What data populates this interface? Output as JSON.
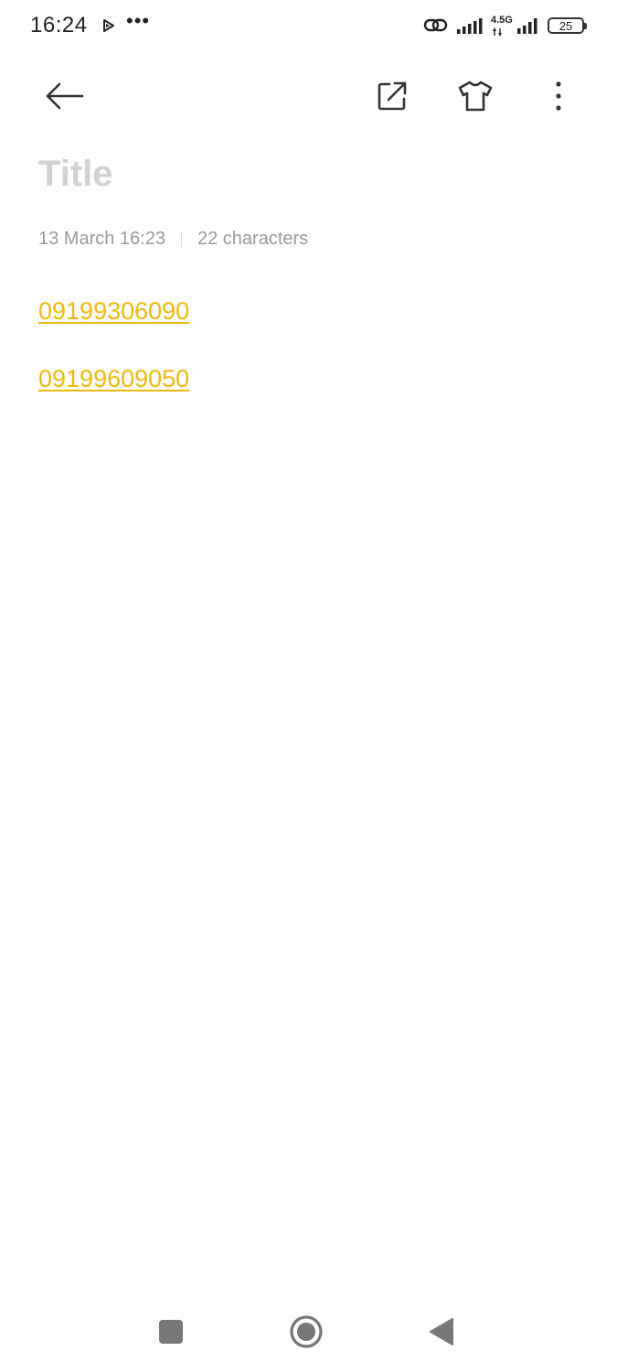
{
  "status_bar": {
    "time": "16:24",
    "network_label": "4.5G",
    "battery_level": "25"
  },
  "note": {
    "title_placeholder": "Title",
    "date": "13 March 16:23",
    "char_count": "22 characters",
    "phone_numbers": [
      "09199306090",
      "09199609050"
    ]
  },
  "colors": {
    "link": "#f0b90b",
    "placeholder": "#d2d2d2",
    "meta_text": "#9a9a9a",
    "icon": "#333333"
  },
  "icons": {
    "back": "arrow-left-icon",
    "share": "external-share-icon",
    "theme": "t-shirt-icon",
    "more": "vertical-dots-icon"
  }
}
